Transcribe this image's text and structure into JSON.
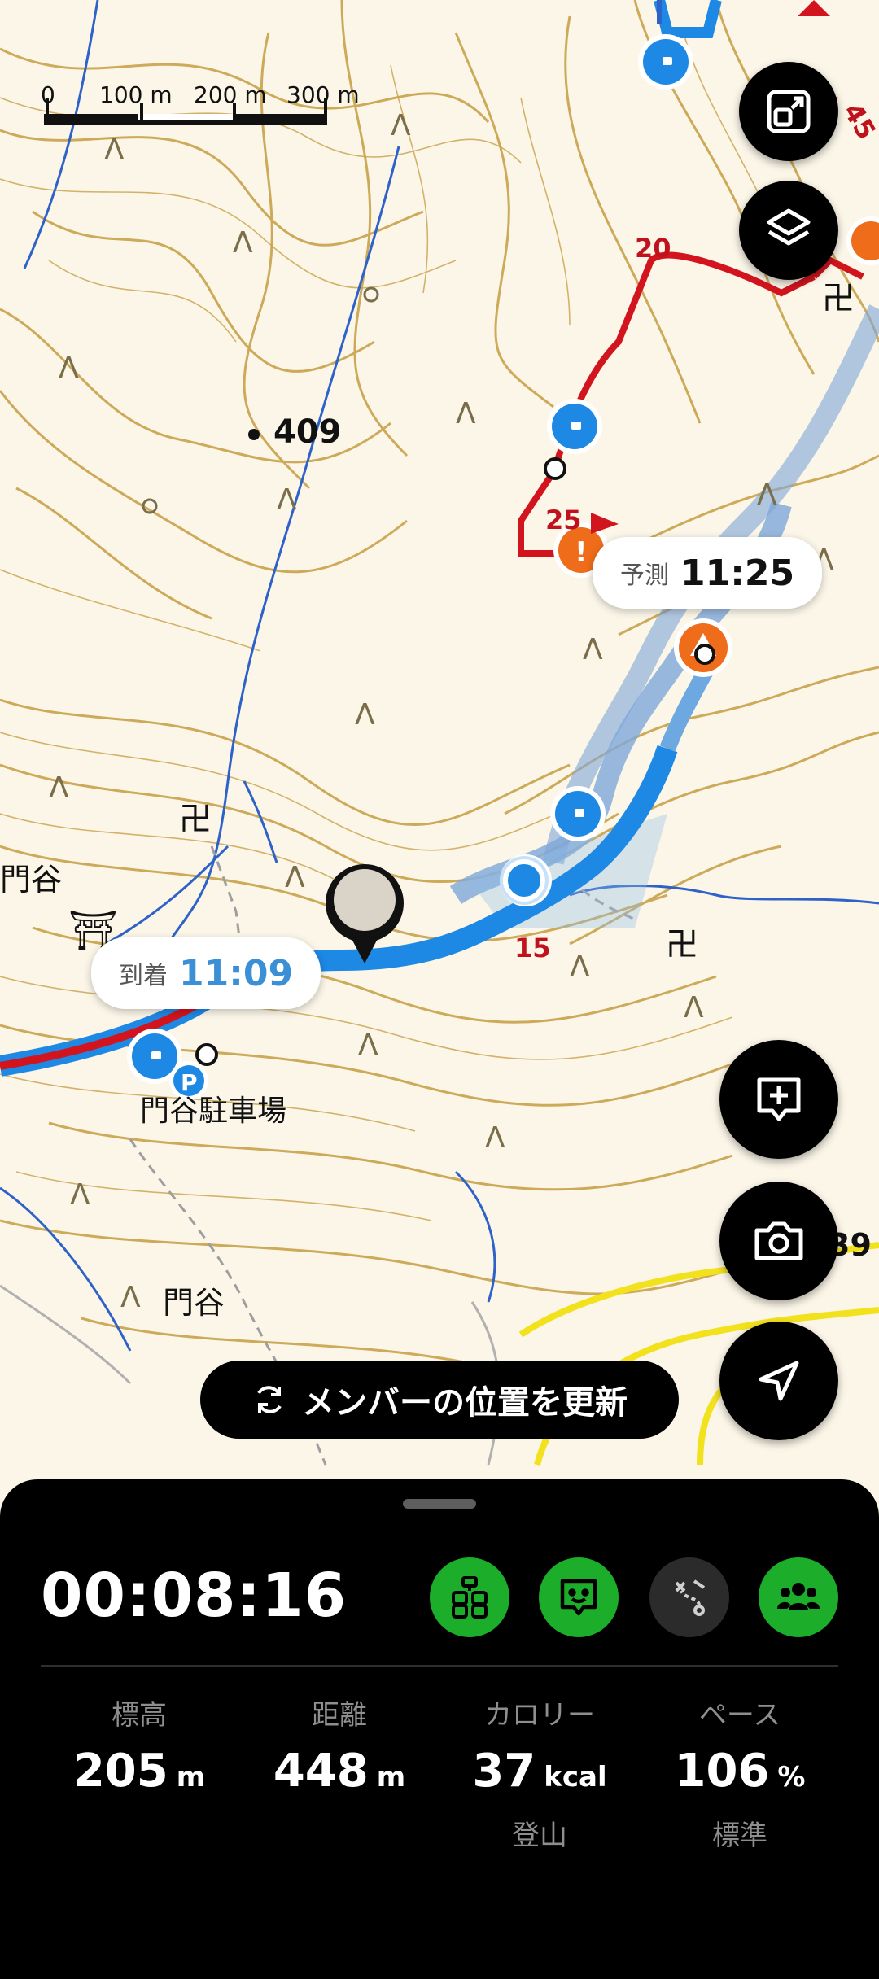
{
  "scale_bar": {
    "ticks": [
      "0",
      "100 m",
      "200 m",
      "300 m"
    ]
  },
  "map_labels": {
    "peak_409": "409",
    "place_kadoya_left": "門谷",
    "parking_name": "門谷駐車場",
    "place_kadoya_bottom": "門谷",
    "partial_39": "39",
    "marker_15": "15",
    "marker_20": "20",
    "marker_25": "25",
    "marker_45": "45"
  },
  "bubbles": {
    "predicted": {
      "label": "予測",
      "time": "11:25"
    },
    "arrival": {
      "label": "到着",
      "time": "11:09"
    }
  },
  "update_button": {
    "label": "メンバーの位置を更新"
  },
  "panel": {
    "elapsed": "00:08:16",
    "stats": [
      {
        "label": "標高",
        "value": "205",
        "unit": "m",
        "sub": ""
      },
      {
        "label": "距離",
        "value": "448",
        "unit": "m",
        "sub": ""
      },
      {
        "label": "カロリー",
        "value": "37",
        "unit": "kcal",
        "sub": "登山"
      },
      {
        "label": "ペース",
        "value": "106",
        "unit": "%",
        "sub": "標準"
      }
    ]
  },
  "icons": {
    "map_fit": "fit-screen-icon",
    "layers": "layers-icon",
    "add_memo": "add-memo-icon",
    "camera": "camera-icon",
    "locate": "navigation-arrow-icon",
    "refresh": "refresh-icon",
    "distance": "distance-markers-icon",
    "chat": "chat-face-icon",
    "route": "route-icon",
    "group": "group-icon"
  },
  "colors": {
    "route_planned": "#d2141e",
    "route_track": "#1e88e5",
    "contour": "#c9a24a",
    "active_green": "#1cad2a"
  }
}
